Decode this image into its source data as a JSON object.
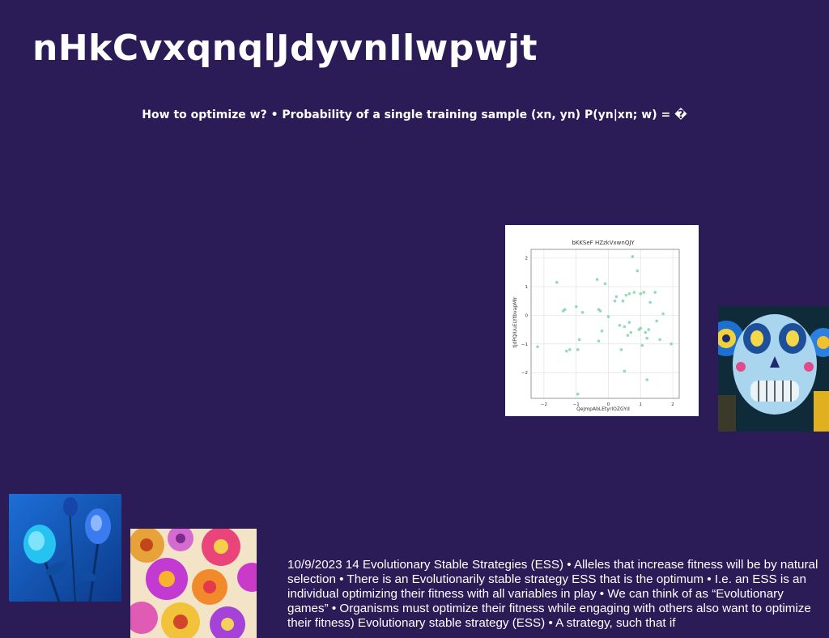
{
  "slide": {
    "title": "nHkCvxqnqlJdyvnIlwpwjt",
    "subtitle": "How to optimize w? • Probability of a single training sample (xn, yn) P(yn|xn; w) = �",
    "body": "10/9/2023 14 Evolutionary Stable Strategies (ESS) • Alleles that increase fitness will be by natural selection • There is an Evolutionarily stable strategy ESS that is the optimum • I.e. an ESS is an individual optimizing their fitness with all variables in play • We can think of as “Evolutionary games” • Organisms must optimize their fitness while engaging with others also want to optimize their fitness) Evolutionary stable strategy (ESS) • A strategy, such that if",
    "background_color": "#2b1c58",
    "images": [
      {
        "name": "sugar-skull-image"
      },
      {
        "name": "blue-roses-image"
      },
      {
        "name": "dahlia-flowers-image"
      }
    ]
  },
  "chart_data": {
    "type": "scatter",
    "title": "bKKSeF HZzkVxwnQJY",
    "xlabel": "QeJmpAbLEtyrIOZGYd",
    "ylabel": "tjdPQIUuELYtbvapMlr",
    "xlim": [
      -2.4,
      2.2
    ],
    "ylim": [
      -2.9,
      2.3
    ],
    "xticks": [
      -2,
      -1,
      0,
      1,
      2
    ],
    "yticks": [
      -2,
      -1,
      0,
      1,
      2
    ],
    "grid": true,
    "color": "#7fd6a8",
    "x": [
      -2.2,
      -1.6,
      -1.4,
      -1.35,
      -1.3,
      -1.2,
      -1.0,
      -0.95,
      -0.9,
      -0.8,
      -0.35,
      -0.3,
      -0.25,
      -0.2,
      -0.1,
      0.0,
      0.2,
      0.25,
      0.35,
      0.4,
      0.45,
      0.5,
      0.55,
      0.6,
      0.65,
      0.7,
      0.75,
      0.8,
      0.9,
      0.95,
      1.0,
      1.05,
      1.1,
      1.15,
      1.2,
      1.25,
      1.3,
      1.45,
      1.5,
      1.6,
      1.7,
      1.95,
      0.5,
      -0.3,
      1.2,
      -0.95,
      0.65,
      1.0
    ],
    "y": [
      -1.1,
      1.15,
      0.15,
      0.2,
      -1.25,
      -1.2,
      0.3,
      -2.75,
      -0.85,
      0.1,
      1.25,
      -0.9,
      0.15,
      -0.55,
      1.1,
      -0.05,
      0.5,
      0.65,
      -0.35,
      -1.2,
      0.5,
      -1.95,
      0.7,
      -0.7,
      -0.25,
      -0.6,
      2.05,
      0.8,
      1.55,
      -0.5,
      0.75,
      -1.05,
      0.8,
      -0.6,
      -0.8,
      -0.5,
      0.45,
      0.8,
      -0.2,
      -0.85,
      0.05,
      -1.0,
      -0.4,
      0.2,
      -2.25,
      -1.2,
      0.75,
      -0.45
    ]
  }
}
